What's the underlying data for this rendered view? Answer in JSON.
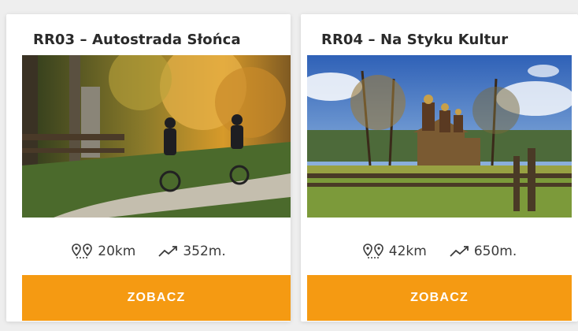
{
  "cards": [
    {
      "title": "RR03 – Autostrada Słońca",
      "image_alt": "cyclists riding gravel road through autumn forest",
      "distance": "20km",
      "elevation": "352m.",
      "button_label": "ZOBACZ"
    },
    {
      "title": "RR04 – Na Styku Kultur",
      "image_alt": "wooden orthodox church in meadow",
      "distance": "42km",
      "elevation": "650m.",
      "button_label": "ZOBACZ"
    }
  ],
  "colors": {
    "button_bg": "#f59a12",
    "button_text": "#ffffff",
    "title_text": "#2a2a2a"
  },
  "icons": {
    "distance": "map-pins-icon",
    "elevation": "trend-up-icon"
  }
}
